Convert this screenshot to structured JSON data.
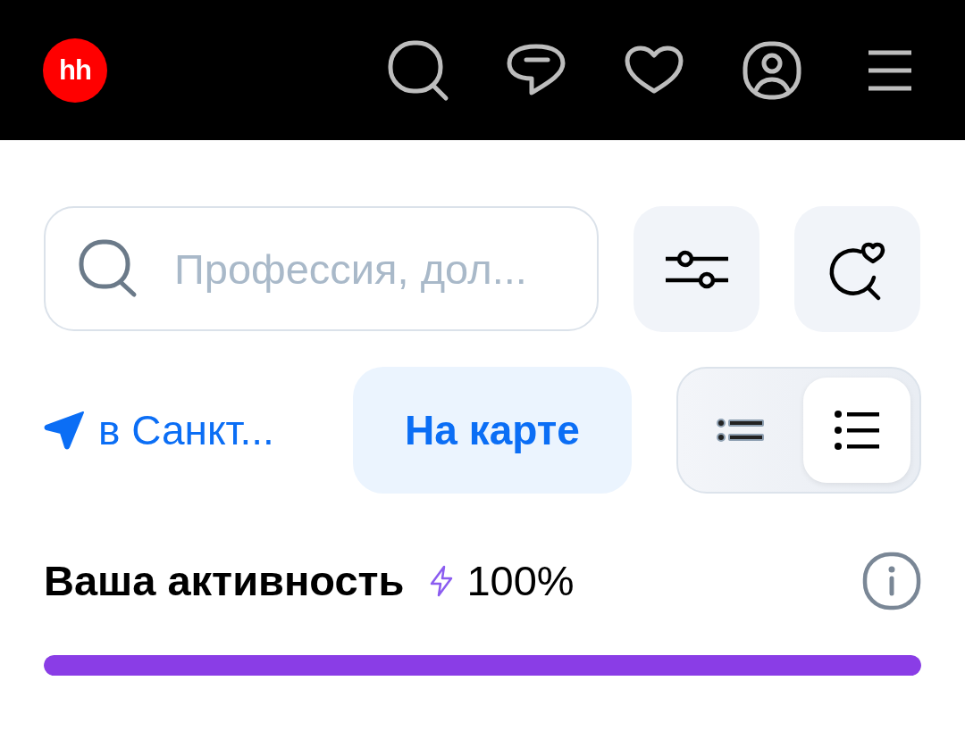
{
  "header": {
    "logo": "hh"
  },
  "search": {
    "placeholder": "Профессия, дол..."
  },
  "location": {
    "label": "в Санкт..."
  },
  "map_button": {
    "label": "На карте"
  },
  "view_toggle": {
    "options": [
      {
        "kind": "compact",
        "selected": false
      },
      {
        "kind": "detailed",
        "selected": true
      }
    ]
  },
  "activity": {
    "title": "Ваша активность",
    "reading": "100%",
    "level": 1
  }
}
